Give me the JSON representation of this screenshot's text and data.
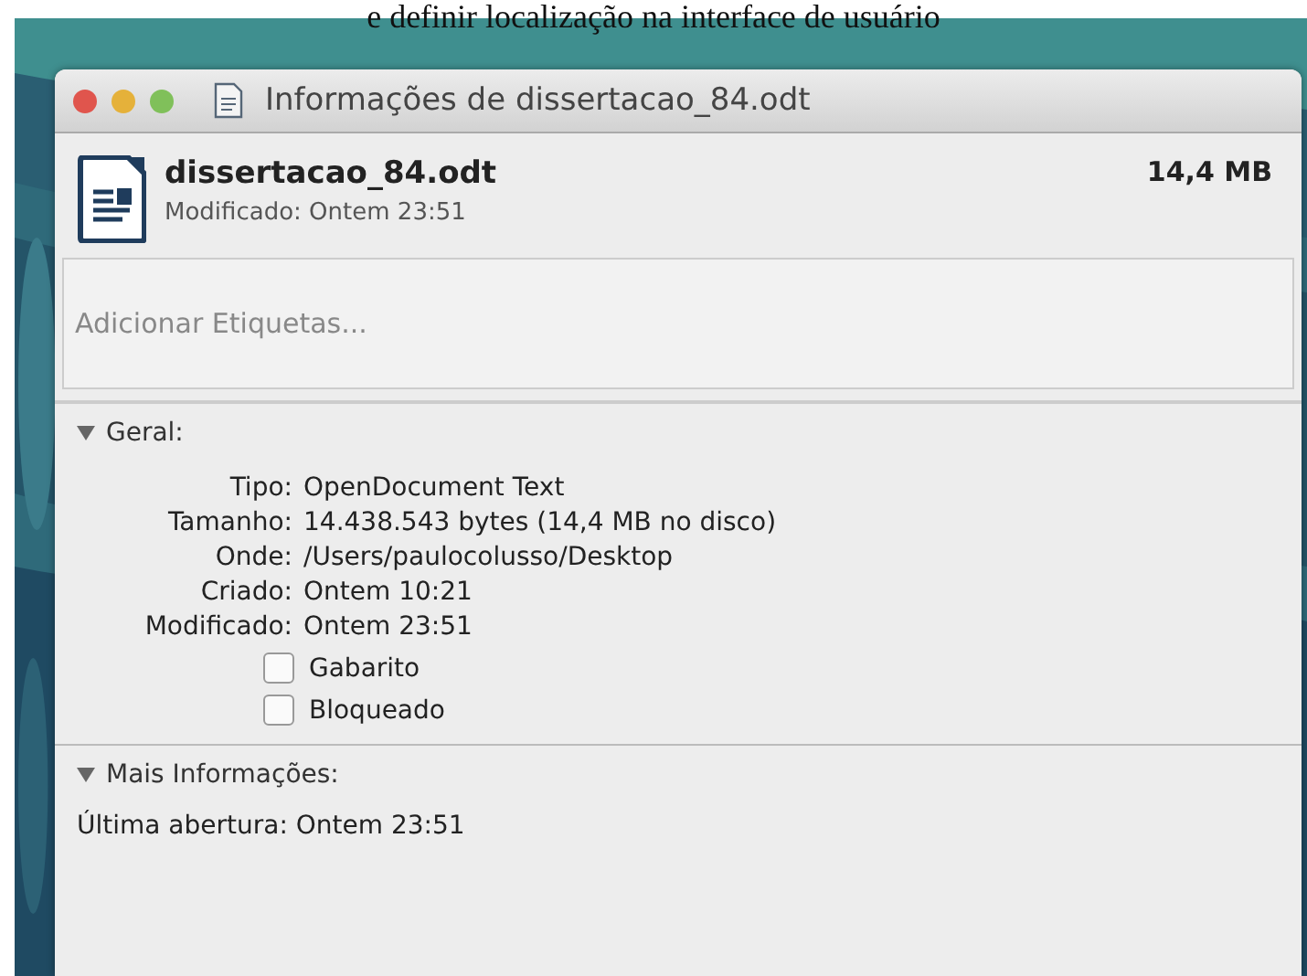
{
  "caption": "e definir localização na interface de usuário",
  "window": {
    "title": "Informações de dissertacao_84.odt"
  },
  "file": {
    "name": "dissertacao_84.odt",
    "modified": "Modificado: Ontem 23:51",
    "size": "14,4 MB"
  },
  "tags_field": {
    "placeholder": "Adicionar Etiquetas..."
  },
  "sections": [
    {
      "title": "Geral:",
      "expanded": true,
      "rows": [
        {
          "label": "Tipo:",
          "value": "OpenDocument Text"
        },
        {
          "label": "Tamanho:",
          "value": "14.438.543 bytes (14,4 MB no disco)"
        },
        {
          "label": "Onde:",
          "value": "/Users/paulocolusso/Desktop"
        },
        {
          "label": "Criado:",
          "value": "Ontem 10:21"
        },
        {
          "label": "Modificado:",
          "value": "Ontem 23:51"
        }
      ],
      "checkboxes": [
        {
          "label": "Gabarito",
          "checked": false
        },
        {
          "label": "Bloqueado",
          "checked": false
        }
      ]
    },
    {
      "title": "Mais Informações:",
      "expanded": true,
      "lines": [
        "Última abertura: Ontem 23:51"
      ]
    }
  ]
}
